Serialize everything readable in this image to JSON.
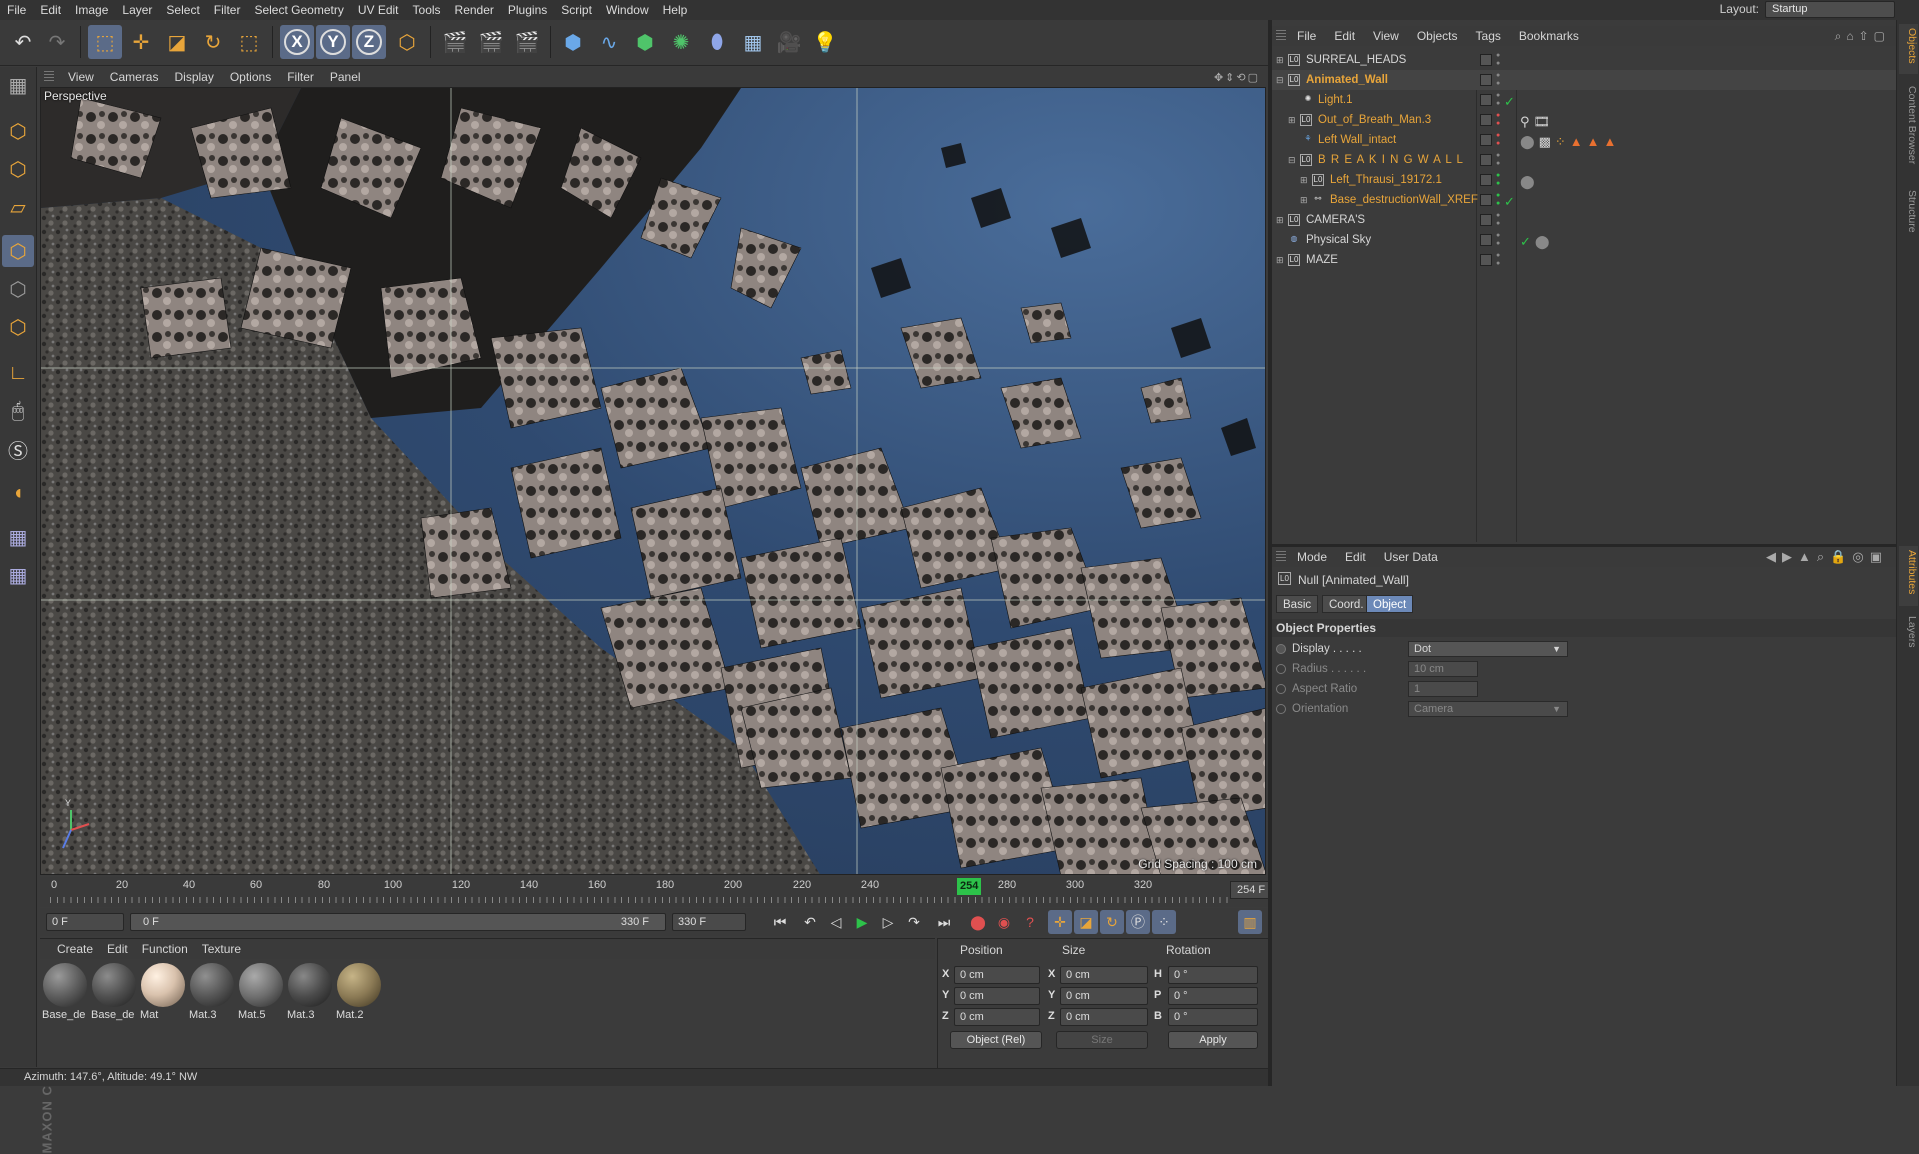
{
  "menu": [
    "File",
    "Edit",
    "Image",
    "Layer",
    "Select",
    "Filter",
    "Select Geometry",
    "UV Edit",
    "Tools",
    "Render",
    "Plugins",
    "Script",
    "Window",
    "Help"
  ],
  "layout": {
    "label": "Layout:",
    "value": "Startup"
  },
  "viewport": {
    "menu": [
      "View",
      "Cameras",
      "Display",
      "Options",
      "Filter",
      "Panel"
    ],
    "title": "Perspective",
    "grid_spacing": "Grid Spacing : 100 cm"
  },
  "timeline": {
    "ticks": [
      "0",
      "20",
      "40",
      "60",
      "80",
      "100",
      "120",
      "140",
      "160",
      "180",
      "200",
      "220",
      "240",
      "280",
      "300",
      "320"
    ],
    "current": "254",
    "current_field": "254 F"
  },
  "transport": {
    "start_field": "0 F",
    "range_start": "0 F",
    "range_end": "330 F",
    "end_field": "330 F"
  },
  "materials": {
    "menu": [
      "Create",
      "Edit",
      "Function",
      "Texture"
    ],
    "items": [
      {
        "label": "Base_de",
        "color": "#5c5c5c"
      },
      {
        "label": "Base_de",
        "color": "#4f4f4f"
      },
      {
        "label": "Mat",
        "color": "#d9c2ad"
      },
      {
        "label": "Mat.3",
        "color": "#555555"
      },
      {
        "label": "Mat.5",
        "color": "#6e6e6e"
      },
      {
        "label": "Mat.3",
        "color": "#4a4a4a"
      },
      {
        "label": "Mat.2",
        "color": "#8b7a55"
      }
    ]
  },
  "coords": {
    "headers": {
      "position": "Position",
      "size": "Size",
      "rotation": "Rotation"
    },
    "pos": [
      {
        "axis": "X",
        "value": "0 cm"
      },
      {
        "axis": "Y",
        "value": "0 cm"
      },
      {
        "axis": "Z",
        "value": "0 cm"
      }
    ],
    "size": [
      {
        "axis": "X",
        "value": "0 cm"
      },
      {
        "axis": "Y",
        "value": "0 cm"
      },
      {
        "axis": "Z",
        "value": "0 cm"
      }
    ],
    "rot": [
      {
        "axis": "H",
        "value": "0 °"
      },
      {
        "axis": "P",
        "value": "0 °"
      },
      {
        "axis": "B",
        "value": "0 °"
      }
    ],
    "mode": "Object (Rel)",
    "size_mode": "Size",
    "apply": "Apply"
  },
  "status": "Azimuth: 147.6°, Altitude: 49.1°  NW",
  "objects": {
    "menu": [
      "File",
      "Edit",
      "View",
      "Objects",
      "Tags",
      "Bookmarks"
    ],
    "rows": [
      {
        "name": "SURREAL_HEADS",
        "color": "#d6d6d6"
      },
      {
        "name": "Animated_Wall",
        "color": "#e8a53a"
      },
      {
        "name": "Light.1",
        "color": "#e8a53a"
      },
      {
        "name": "Out_of_Breath_Man.3",
        "color": "#e8a53a"
      },
      {
        "name": "Left Wall_intact",
        "color": "#e8a53a"
      },
      {
        "name": "B R E A K I N G  W A L L",
        "color": "#e8a53a"
      },
      {
        "name": "Left_Thrausi_19172.1",
        "color": "#e8a53a"
      },
      {
        "name": "Base_destructionWall_XREF",
        "color": "#e8a53a"
      },
      {
        "name": "CAMERA'S",
        "color": "#d6d6d6"
      },
      {
        "name": "Physical Sky",
        "color": "#d6d6d6"
      },
      {
        "name": "MAZE",
        "color": "#d6d6d6"
      }
    ]
  },
  "attributes": {
    "menu": [
      "Mode",
      "Edit",
      "User Data"
    ],
    "object_title": "Null [Animated_Wall]",
    "tabs": [
      "Basic",
      "Coord.",
      "Object"
    ],
    "section": "Object Properties",
    "props": [
      {
        "label": "Display . . . . .",
        "value": "Dot"
      },
      {
        "label": "Radius . . . . . .",
        "value": "10 cm"
      },
      {
        "label": "Aspect Ratio",
        "value": "1"
      },
      {
        "label": "Orientation",
        "value": "Camera"
      }
    ]
  },
  "side_tabs": [
    "Objects",
    "Content Browser",
    "Structure",
    "Attributes",
    "Layers"
  ]
}
